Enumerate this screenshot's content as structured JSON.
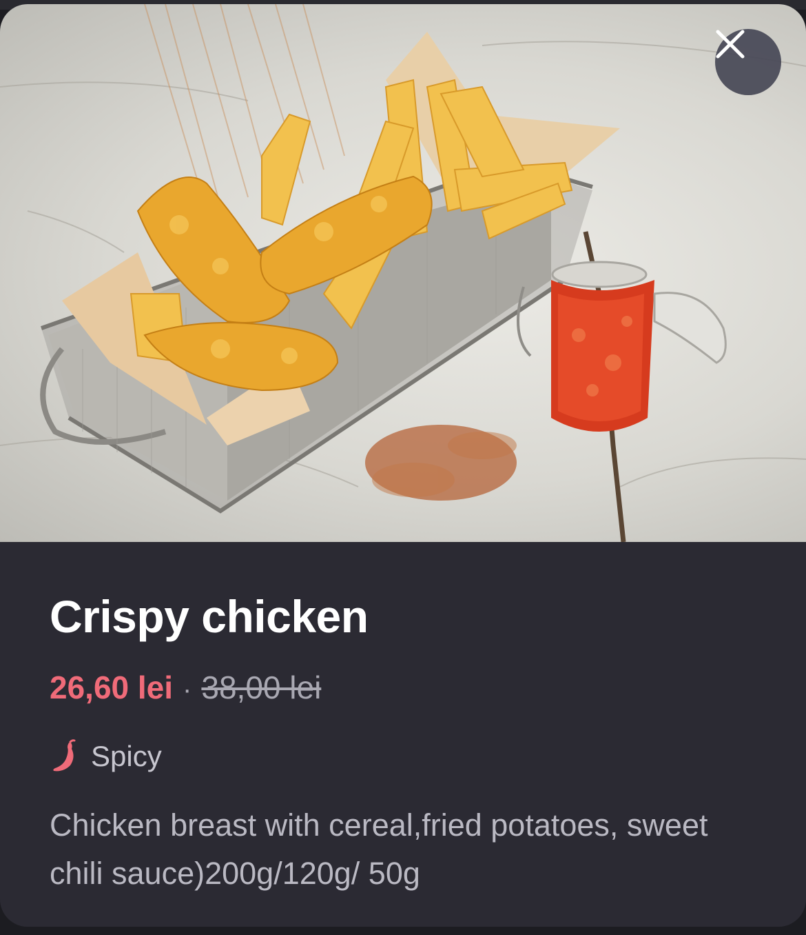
{
  "product": {
    "name": "Crispy chicken",
    "price_current": "26,60 lei",
    "price_separator": "·",
    "price_original": "38,00 lei",
    "tag": {
      "label": "Spicy",
      "icon": "chili-pepper-icon"
    },
    "description": "Chicken breast with cereal,fried potatoes, sweet chili sauce)200g/120g/ 50g",
    "image": "food-photo-crispy-chicken-fries-basket-chili-sauce"
  },
  "controls": {
    "close_icon": "close-icon"
  },
  "colors": {
    "sheet_background": "#2b2a33",
    "price_accent": "#f06b79",
    "muted_text": "#a9a8b2",
    "close_button": "#464856"
  }
}
